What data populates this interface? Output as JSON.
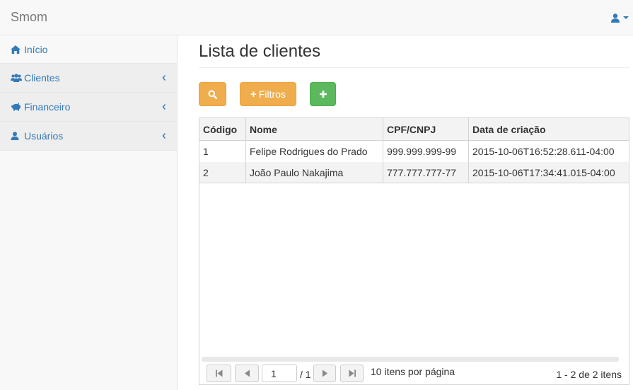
{
  "app": {
    "brand": "Smom"
  },
  "sidebar": {
    "items": [
      {
        "label": "Início",
        "icon": "home-icon"
      },
      {
        "label": "Clientes",
        "icon": "users-icon"
      },
      {
        "label": "Financeiro",
        "icon": "piggy-bank-icon"
      },
      {
        "label": "Usuários",
        "icon": "user-icon"
      }
    ]
  },
  "main": {
    "title": "Lista de clientes",
    "buttons": {
      "filter_label": "Filtros"
    }
  },
  "table": {
    "columns": [
      "Código",
      "Nome",
      "CPF/CNPJ",
      "Data de criação"
    ],
    "rows": [
      [
        "1",
        "Felipe Rodrigues do Prado",
        "999.999.999-99",
        "2015-10-06T16:52:28.611-04:00"
      ],
      [
        "2",
        "João Paulo Nakajima",
        "777.777.777-77",
        "2015-10-06T17:34:41.015-04:00"
      ]
    ]
  },
  "pager": {
    "current_page": "1",
    "total_pages": "/ 1",
    "page_size_label": "10 itens por página",
    "count_label": "1 - 2 de 2 itens"
  },
  "colors": {
    "link": "#337ab7",
    "warning": "#f0ad4e",
    "success": "#5cb85c"
  }
}
